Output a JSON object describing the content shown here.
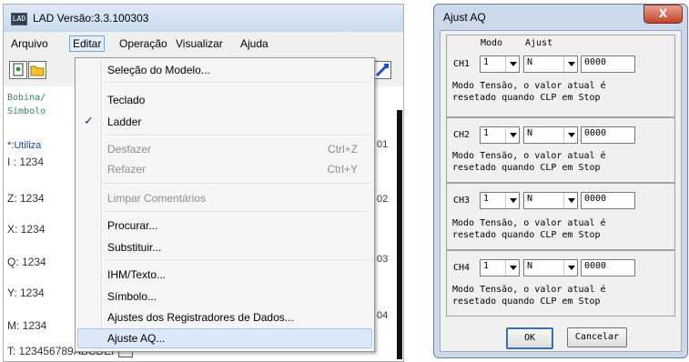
{
  "left_window": {
    "title": "LAD Versão:3.3.100303",
    "app_icon_text": "LAD",
    "menubar": [
      "Arquivo",
      "Editar",
      "Operação",
      "Visualizar",
      "Ajuda"
    ],
    "editor": {
      "code_line_1": "Bobina/",
      "code_line_2": "Símbolo",
      "utiliz_label": "*:Utiliza",
      "rows": [
        "I : 1234",
        "Z: 1234",
        "X: 1234",
        "Q: 1234",
        "Y: 1234",
        "M: 1234",
        "T: 123456789ABCDEF"
      ],
      "right_numbers": [
        "01",
        "02",
        "03",
        "04"
      ],
      "more_button": "..."
    }
  },
  "edit_menu": {
    "items": [
      {
        "label": "Seleção do Modelo...",
        "enabled": true
      },
      {
        "label": "Teclado",
        "enabled": true
      },
      {
        "label": "Ladder",
        "enabled": true,
        "checked": true
      },
      {
        "label": "Desfazer",
        "enabled": false,
        "shortcut": "Ctrl+Z"
      },
      {
        "label": "Refazer",
        "enabled": false,
        "shortcut": "Ctrl+Y"
      },
      {
        "label": "Limpar Comentários",
        "enabled": false
      },
      {
        "label": "Procurar...",
        "enabled": true
      },
      {
        "label": "Substituir...",
        "enabled": true
      },
      {
        "label": "IHM/Texto...",
        "enabled": true
      },
      {
        "label": "Símbolo...",
        "enabled": true
      },
      {
        "label": "Ajustes dos Registradores de Dados...",
        "enabled": true
      },
      {
        "label": "Ajuste AQ...",
        "enabled": true,
        "highlighted": true
      }
    ],
    "check_glyph": "✓"
  },
  "dialog": {
    "title": "Ajust AQ",
    "close_glyph": "X",
    "header_modo": "Modo",
    "header_ajust": "Ajust",
    "channels": [
      {
        "label": "CH1",
        "modo": "1",
        "ajust": "N",
        "value": "0000",
        "desc_1": "Modo Tensão, o valor atual é",
        "desc_2": "resetado quando CLP em Stop"
      },
      {
        "label": "CH2",
        "modo": "1",
        "ajust": "N",
        "value": "0000",
        "desc_1": "Modo Tensão, o valor atual é",
        "desc_2": "resetado quando CLP em Stop"
      },
      {
        "label": "CH3",
        "modo": "1",
        "ajust": "N",
        "value": "0000",
        "desc_1": "Modo Tensão, o valor atual é",
        "desc_2": "resetado quando CLP em Stop"
      },
      {
        "label": "CH4",
        "modo": "1",
        "ajust": "N",
        "value": "0000",
        "desc_1": "Modo Tensão, o valor atual é",
        "desc_2": "resetado quando CLP em Stop"
      }
    ],
    "ok_label": "OK",
    "cancel_label": "Cancelar"
  }
}
